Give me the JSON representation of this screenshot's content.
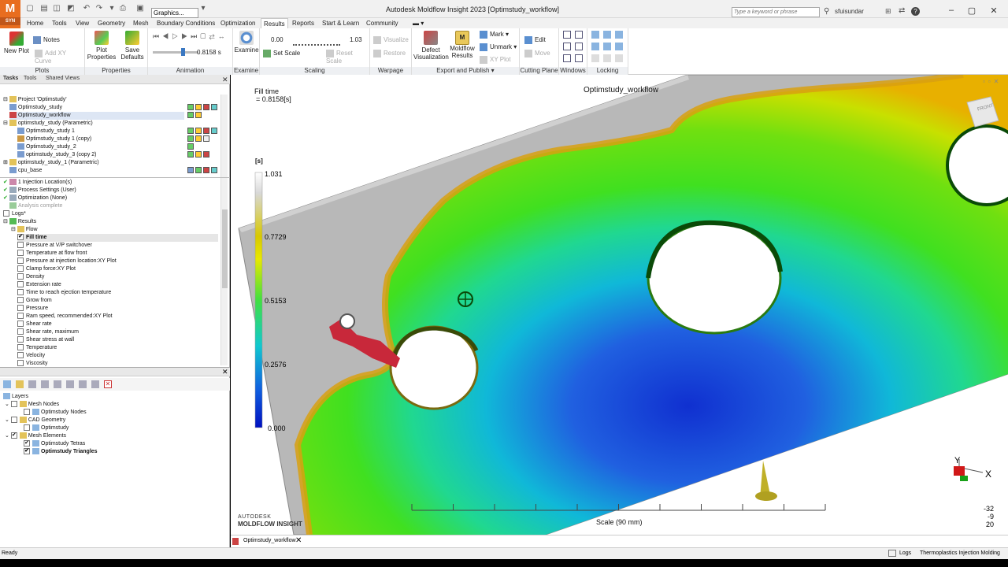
{
  "app": {
    "logo_letter": "M",
    "logo_sub": "SYN",
    "title": "Autodesk Moldflow Insight 2023    [Optimstudy_workflow]",
    "graphics_select": "Graphics...",
    "search_placeholder": "Type a keyword or phrase",
    "user": "sfuisundar"
  },
  "menu_tabs": [
    "Home",
    "Tools",
    "View",
    "Geometry",
    "Mesh",
    "Boundary Conditions",
    "Optimization",
    "Results",
    "Reports",
    "Start & Learn",
    "Community"
  ],
  "active_tab": "Results",
  "ribbon": {
    "plots": {
      "label": "Plots",
      "new_plot": "New Plot",
      "notes": "Notes",
      "add_xy": "Add XY Curve"
    },
    "properties": {
      "label": "Properties",
      "plot_properties": "Plot Properties",
      "save_defaults": "Save Defaults"
    },
    "animation": {
      "label": "Animation",
      "time": "0.8158 s"
    },
    "examine": {
      "label": "Examine",
      "examine": "Examine"
    },
    "scaling": {
      "label": "Scaling",
      "min": "0.00",
      "max": "1.03",
      "set_scale": "Set Scale",
      "reset_scale": "Reset Scale"
    },
    "warpage": {
      "label": "Warpage",
      "visualize": "Visualize",
      "restore": "Restore"
    },
    "export": {
      "label": "Export and Publish",
      "defect": "Defect Visualization",
      "moldflow": "Moldflow Results",
      "mark": "Mark",
      "unmark": "Unmark",
      "xyplot": "XY Plot"
    },
    "cutting": {
      "label": "Cutting Plane",
      "edit": "Edit",
      "move": "Move"
    },
    "windows": {
      "label": "Windows"
    },
    "locking": {
      "label": "Locking"
    }
  },
  "panel_tabs": [
    "Tasks",
    "Tools",
    "Shared Views"
  ],
  "project_tree": [
    {
      "label": "Project 'Optimstudy'",
      "indent": 0,
      "expander": "-"
    },
    {
      "label": "Optimstudy_study",
      "indent": 1
    },
    {
      "label": "Optimstudy_workflow",
      "indent": 1,
      "selected": true
    },
    {
      "label": "optimstudy_study (Parametric)",
      "indent": 0,
      "expander": "-"
    },
    {
      "label": "Optimstudy_study 1",
      "indent": 2
    },
    {
      "label": "Optimstudy_study 1 (copy)",
      "indent": 2
    },
    {
      "label": "Optimstudy_study_2",
      "indent": 2
    },
    {
      "label": "optimstudy_study_3 (copy 2)",
      "indent": 2
    },
    {
      "label": "optimstudy_study_1 (Parametric)",
      "indent": 0,
      "expander": "+"
    },
    {
      "label": "cpu_base",
      "indent": 1
    }
  ],
  "study_tasks": [
    {
      "label": "1 Injection Location(s)",
      "check": "✔"
    },
    {
      "label": "Process Settings (User)",
      "check": "✔"
    },
    {
      "label": "Optimization (None)",
      "check": "✔"
    },
    {
      "label": "Analysis complete",
      "check": "",
      "dim": true
    }
  ],
  "logs_label": "Logs*",
  "results_label": "Results",
  "flow_label": "Flow",
  "results": [
    {
      "label": "Fill time",
      "checked": true,
      "bold": true
    },
    {
      "label": "Pressure at V/P switchover"
    },
    {
      "label": "Temperature at flow front"
    },
    {
      "label": "Pressure at injection location:XY Plot"
    },
    {
      "label": "Clamp force:XY Plot"
    },
    {
      "label": "Density"
    },
    {
      "label": "Extension rate"
    },
    {
      "label": "Time to reach ejection temperature"
    },
    {
      "label": "Grow from"
    },
    {
      "label": "Pressure"
    },
    {
      "label": "Ram speed, recommended:XY Plot"
    },
    {
      "label": "Shear rate"
    },
    {
      "label": "Shear rate, maximum"
    },
    {
      "label": "Shear stress at wall"
    },
    {
      "label": "Temperature"
    },
    {
      "label": "Velocity"
    },
    {
      "label": "Viscosity"
    }
  ],
  "layers": {
    "root": "Layers",
    "items": [
      {
        "label": "Mesh Nodes",
        "indent": 1,
        "checked": false,
        "folder": true
      },
      {
        "label": "Optimstudy Nodes",
        "indent": 2,
        "checked": false
      },
      {
        "label": "CAD Geometry",
        "indent": 1,
        "checked": false,
        "folder": true
      },
      {
        "label": "Optimstudy",
        "indent": 2,
        "checked": false
      },
      {
        "label": "Mesh Elements",
        "indent": 1,
        "checked": true,
        "folder": true
      },
      {
        "label": "Optimstudy Tetras",
        "indent": 2,
        "checked": true
      },
      {
        "label": "Optimstudy Triangles",
        "indent": 2,
        "checked": true,
        "bold": true
      }
    ]
  },
  "viewport": {
    "result_title": "Fill time",
    "result_value": "= 0.8158[s]",
    "model_name": "Optimstudy_workflow",
    "legend_unit": "[s]",
    "legend_ticks": [
      "1.031",
      "0.7729",
      "0.5153",
      "0.2576",
      "0.000"
    ],
    "scale_label": "Scale (90 mm)",
    "brand_line1": "AUTODESK",
    "brand_line2": "MOLDFLOW INSIGHT",
    "axis_y": "Y",
    "axis_x": "X",
    "coords": [
      "-32",
      "-9",
      "20"
    ],
    "viewcube_label": "FRONT"
  },
  "doc_tab": "Optimstudy_workflow",
  "status": {
    "left": "Ready",
    "logs": "Logs",
    "analysis": "Thermoplastics Injection Molding"
  }
}
